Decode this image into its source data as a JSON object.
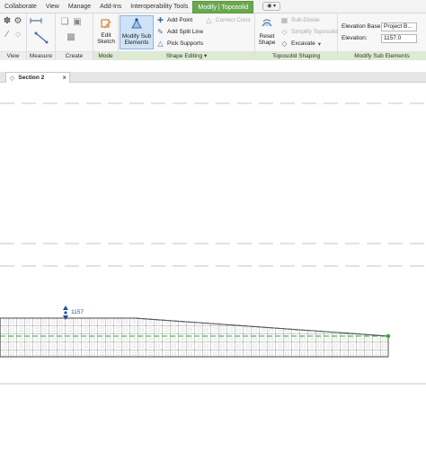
{
  "tabs": [
    {
      "label": "Collaborate",
      "active": false
    },
    {
      "label": "View",
      "active": false
    },
    {
      "label": "Manage",
      "active": false
    },
    {
      "label": "Add-Ins",
      "active": false
    },
    {
      "label": "Interoperability Tools",
      "active": false
    },
    {
      "label": "Modify | Toposolid",
      "active": true
    },
    {
      "label": "◉ ▾",
      "active": false
    }
  ],
  "panels": {
    "view": {
      "label": "View"
    },
    "measure": {
      "label": "Measure"
    },
    "create": {
      "label": "Create"
    },
    "mode": {
      "label": "Mode",
      "edit_sketch": "Edit Sketch"
    },
    "shape_editing": {
      "label": "Shape Editing",
      "modify_sub_elements": "Modify Sub Elements",
      "add_point": "Add Point",
      "add_split_line": "Add Split Line",
      "pick_supports": "Pick Supports",
      "correct_crest": "Correct Crest"
    },
    "toposolid_shaping": {
      "label": "Toposolid Shaping",
      "reset_shape": "Reset Shape",
      "sub_divide": "Sub-Divide",
      "simplify_toposolid": "Simplify Toposolid",
      "excavate": "Excavate"
    },
    "modify_sub_elements": {
      "label": "Modify Sub Elements",
      "elevation_base_label": "Elevation Base:",
      "elevation_base_value": "Project B...",
      "elevation_label": "Elevation:",
      "elevation_value": "1157.0"
    }
  },
  "view_tab": {
    "label": "Section 2",
    "close": "×"
  },
  "canvas": {
    "elevation_tag": "1157"
  },
  "colors": {
    "accent": "#6aa84f",
    "tag_blue": "#1f4e9c",
    "point_green": "#2fa82f"
  }
}
